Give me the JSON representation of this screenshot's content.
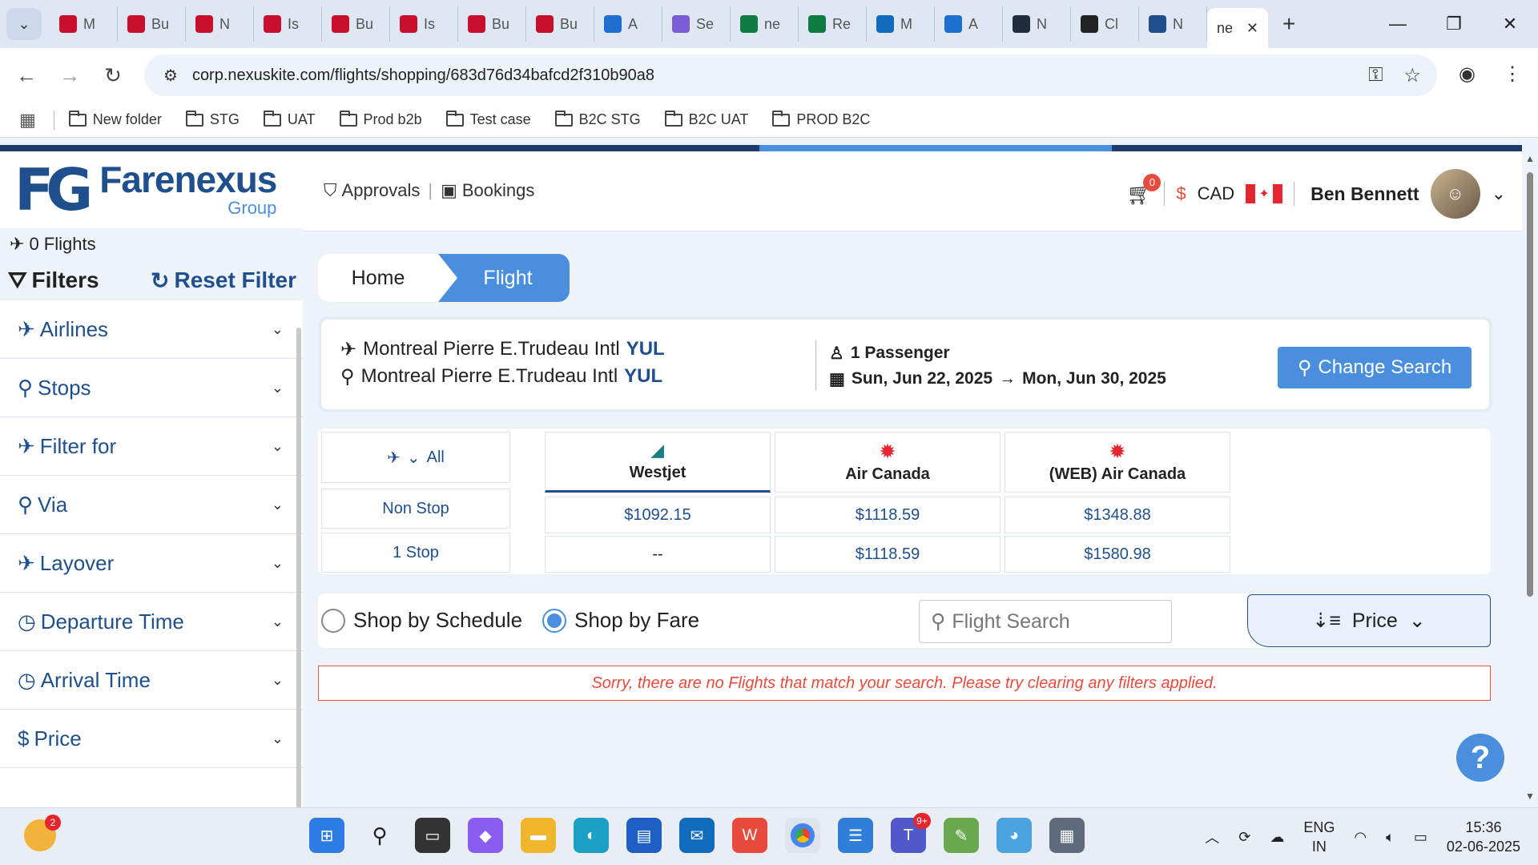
{
  "browser": {
    "tabs": [
      {
        "label": "M",
        "icon": "red-arc-icon",
        "color": "#c8102e"
      },
      {
        "label": "Bu",
        "icon": "red-arc-icon",
        "color": "#c8102e"
      },
      {
        "label": "N",
        "icon": "red-arc-icon",
        "color": "#c8102e"
      },
      {
        "label": "Is",
        "icon": "red-arc-icon",
        "color": "#c8102e"
      },
      {
        "label": "Bu",
        "icon": "red-arc-icon",
        "color": "#c8102e"
      },
      {
        "label": "Is",
        "icon": "red-arc-icon",
        "color": "#c8102e"
      },
      {
        "label": "Bu",
        "icon": "red-arc-icon",
        "color": "#c8102e"
      },
      {
        "label": "Bu",
        "icon": "red-arc-icon",
        "color": "#c8102e"
      },
      {
        "label": "A",
        "icon": "link-icon",
        "color": "#1f6fd1"
      },
      {
        "label": "Se",
        "icon": "copilot-icon",
        "color": "#7b5cd6"
      },
      {
        "label": "ne",
        "icon": "excel-icon",
        "color": "#107c41"
      },
      {
        "label": "Re",
        "icon": "excel-icon",
        "color": "#107c41"
      },
      {
        "label": "M",
        "icon": "outlook-icon",
        "color": "#0f6cbd"
      },
      {
        "label": "A",
        "icon": "link-icon",
        "color": "#1f6fd1"
      },
      {
        "label": "N",
        "icon": "p-icon",
        "color": "#1f2d3d"
      },
      {
        "label": "Cl",
        "icon": "openai-icon",
        "color": "#222222"
      },
      {
        "label": "N",
        "icon": "d-icon",
        "color": "#1f4f8c"
      }
    ],
    "active_tab": {
      "label": "ne"
    },
    "url": "corp.nexuskite.com/flights/shopping/683d76d34bafcd2f310b90a8",
    "bookmarks": [
      "New folder",
      "STG",
      "UAT",
      "Prod b2b",
      "Test case",
      "B2C STG",
      "B2C UAT",
      "PROD B2C"
    ]
  },
  "app": {
    "logo": {
      "mark": "FG",
      "name": "Farenexus",
      "sub": "Group"
    },
    "nav": {
      "approvals": "Approvals",
      "bookings": "Bookings"
    },
    "cart_count": "0",
    "currency_symbol": "$",
    "currency": "CAD",
    "user_name": "Ben Bennett"
  },
  "sidebar": {
    "flight_count": "0 Flights",
    "filters_label": "Filters",
    "reset_label": "Reset Filter",
    "items": [
      {
        "label": "Airlines",
        "icon": "airline-icon"
      },
      {
        "label": "Stops",
        "icon": "pin-icon"
      },
      {
        "label": "Filter for",
        "icon": "plane-filter-icon"
      },
      {
        "label": "Via",
        "icon": "location-icon"
      },
      {
        "label": "Layover",
        "icon": "layover-icon"
      },
      {
        "label": "Departure Time",
        "icon": "clock-icon"
      },
      {
        "label": "Arrival Time",
        "icon": "clock-icon"
      },
      {
        "label": "Price",
        "icon": "dollar-icon"
      }
    ]
  },
  "breadcrumb": {
    "home": "Home",
    "current": "Flight"
  },
  "search_summary": {
    "origin_name": "Montreal Pierre E.Trudeau Intl",
    "origin_code": "YUL",
    "destination_name": "Montreal Pierre E.Trudeau Intl",
    "destination_code": "YUL",
    "passengers": "1 Passenger",
    "depart_date": "Sun, Jun 22, 2025",
    "return_date": "Mon, Jun 30, 2025",
    "change_button": "Change Search"
  },
  "fare_matrix": {
    "filter_label": "All",
    "rows": [
      "Non Stop",
      "1 Stop"
    ],
    "airlines": [
      {
        "name": "Westjet",
        "prices": [
          "$1092.15",
          "--"
        ],
        "selected": true
      },
      {
        "name": "Air Canada",
        "prices": [
          "$1118.59",
          "$1118.59"
        ],
        "selected": false
      },
      {
        "name": "(WEB) Air Canada",
        "prices": [
          "$1348.88",
          "$1580.98"
        ],
        "selected": false
      }
    ]
  },
  "shop_bar": {
    "schedule_label": "Shop by Schedule",
    "fare_label": "Shop by Fare",
    "selected": "fare",
    "search_placeholder": "Flight Search",
    "sort_label": "Price"
  },
  "no_results_message": "Sorry, there are no Flights that match your search. Please try clearing any filters applied.",
  "taskbar": {
    "weather_badge": "2",
    "teams_badge": "9+",
    "lang_line1": "ENG",
    "lang_line2": "IN",
    "time": "15:36",
    "date": "02-06-2025"
  },
  "colors": {
    "brand": "#1f4f8c",
    "accent": "#4a8fdd",
    "error": "#e84a3c"
  }
}
